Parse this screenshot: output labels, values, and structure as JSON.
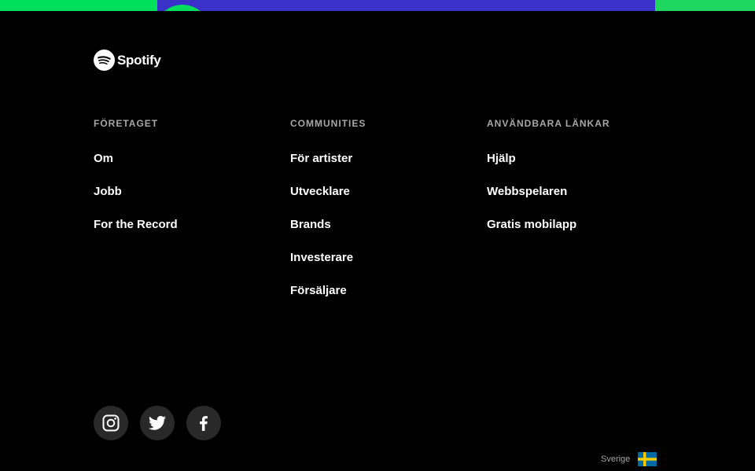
{
  "brand": {
    "name": "Spotify"
  },
  "footer": {
    "columns": [
      {
        "title": "FÖRETAGET",
        "links": [
          "Om",
          "Jobb",
          "For the Record"
        ]
      },
      {
        "title": "COMMUNITIES",
        "links": [
          "För artister",
          "Utvecklare",
          "Brands",
          "Investerare",
          "Försäljare"
        ]
      },
      {
        "title": "ANVÄNDBARA LÄNKAR",
        "links": [
          "Hjälp",
          "Webbspelaren",
          "Gratis mobilapp"
        ]
      }
    ],
    "social": [
      "instagram-icon",
      "twitter-icon",
      "facebook-icon"
    ],
    "country": "Sverige"
  },
  "colors": {
    "background": "#000000",
    "accent_green": "#1ed760",
    "banner_blue": "#3a31c8",
    "heading_gray": "#a7a7a7",
    "social_bg": "#292929"
  }
}
